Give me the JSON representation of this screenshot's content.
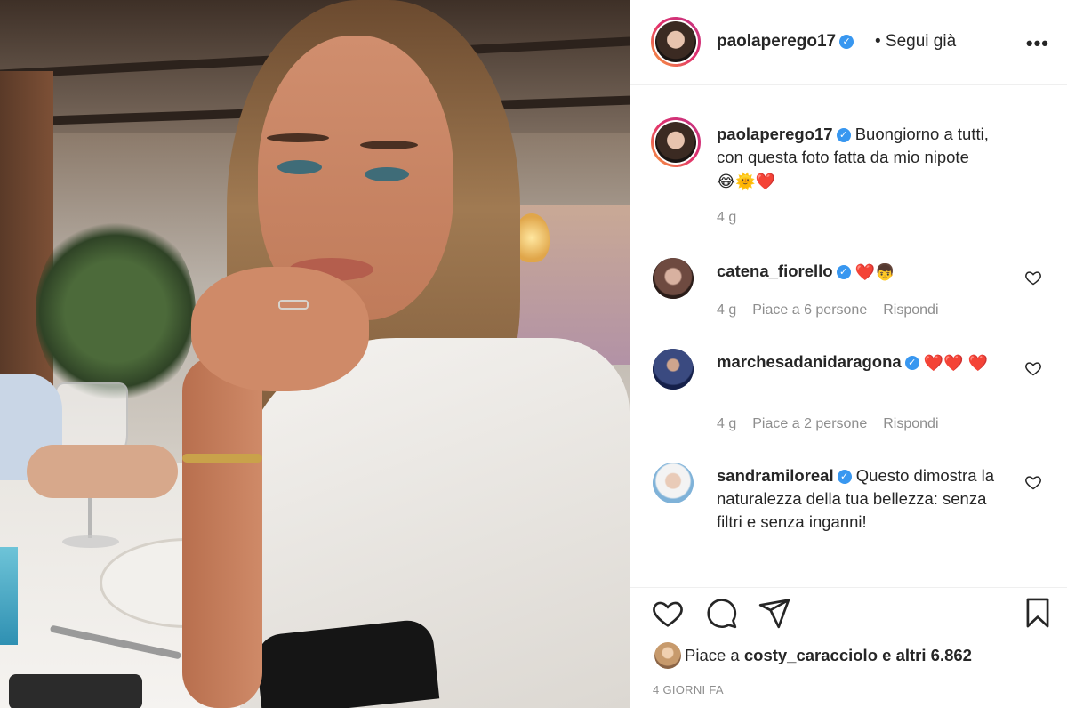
{
  "post": {
    "author": {
      "username": "paolaperego17",
      "verified": true
    },
    "header": {
      "follow_status": "• Segui già",
      "more_icon": "more-horizontal-icon"
    },
    "caption": {
      "username": "paolaperego17",
      "text": "Buongiorno a tutti, con questa foto fatta da mio nipote",
      "emojis": "😂🌞❤️",
      "time": "4 g"
    },
    "comments": [
      {
        "username": "catena_fiorello",
        "text": "❤️👦",
        "time": "4 g",
        "likes": "Piace a 6 persone",
        "reply": "Rispondi"
      },
      {
        "username": "marchesadanidaragona",
        "text": "❤️❤️ ❤️",
        "time": "4 g",
        "likes": "Piace a 2 persone",
        "reply": "Rispondi"
      },
      {
        "username": "sandramiloreal",
        "text": "Questo dimostra la naturalezza della tua bellezza: senza filtri e senza inganni!"
      }
    ],
    "actions": [
      "heart-icon",
      "comment-icon",
      "share-icon",
      "bookmark-icon"
    ],
    "likes_text": {
      "prefix": "Piace a",
      "user": "costy_caracciolo",
      "suffix": "e altri 6.862"
    },
    "date": "4 GIORNI FA",
    "colors": {
      "verified": "#3897f0",
      "heart": "#ed4956",
      "meta": "#8e8e8e"
    }
  }
}
